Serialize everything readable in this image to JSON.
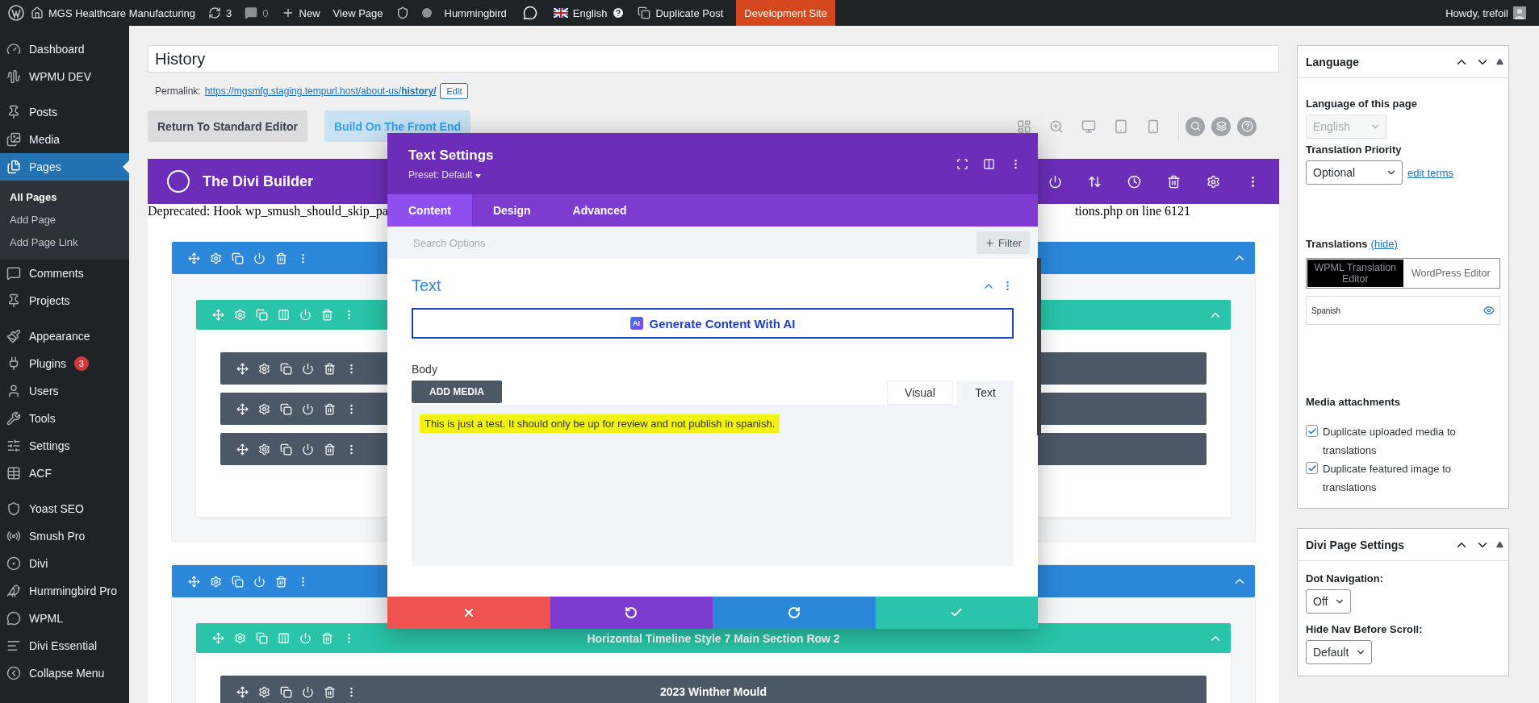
{
  "admin_bar": {
    "site": "MGS Healthcare Manufacturing",
    "updates": "3",
    "comments": "0",
    "new": "New",
    "view": "View Page",
    "hummingbird": "Hummingbird",
    "language": "English",
    "duplicate": "Duplicate Post",
    "environment": "Development Site",
    "greeting": "Howdy, trefoil"
  },
  "sidebar": {
    "groups": [
      [
        {
          "label": "Dashboard",
          "selected": false
        },
        {
          "label": "WPMU DEV",
          "selected": false
        }
      ],
      [
        {
          "label": "Posts",
          "selected": false
        },
        {
          "label": "Media",
          "selected": false
        },
        {
          "label": "Pages",
          "selected": true,
          "children": [
            {
              "label": "All Pages",
              "selected": true
            },
            {
              "label": "Add Page",
              "selected": false
            },
            {
              "label": "Add Page Link",
              "selected": false
            }
          ]
        },
        {
          "label": "Comments",
          "selected": false
        },
        {
          "label": "Projects",
          "selected": false
        }
      ],
      [
        {
          "label": "Appearance",
          "selected": false
        },
        {
          "label": "Plugins",
          "selected": false,
          "badge": "3"
        },
        {
          "label": "Users",
          "selected": false
        },
        {
          "label": "Tools",
          "selected": false
        },
        {
          "label": "Settings",
          "selected": false
        },
        {
          "label": "ACF",
          "selected": false
        }
      ],
      [
        {
          "label": "Yoast SEO",
          "selected": false
        },
        {
          "label": "Smush Pro",
          "selected": false
        },
        {
          "label": "Divi",
          "selected": false
        },
        {
          "label": "Hummingbird Pro",
          "selected": false
        },
        {
          "label": "WPML",
          "selected": false
        },
        {
          "label": "Divi Essential",
          "selected": false
        },
        {
          "label": "Collapse Menu",
          "selected": false
        }
      ]
    ]
  },
  "editor": {
    "title": "History",
    "permalink_label": "Permalink:",
    "permalink_base": "https://mgsmfg.staging.tempurl.host/about-us/",
    "permalink_slug": "history/",
    "edit": "Edit",
    "return_button": "Return To Standard Editor",
    "front_end_button": "Build On The Front End",
    "builder_title": "The Divi Builder",
    "notice_start": "Deprecated: Hook wp_smush_should_skip_pa",
    "notice_end": "tions.php on line 6121"
  },
  "builder": {
    "sections": [
      {
        "kind": "section",
        "rows": [
          {
            "kind": "row",
            "modules": [
              {
                "kind": "module"
              },
              {
                "kind": "module"
              },
              {
                "kind": "module"
              }
            ]
          }
        ]
      },
      {
        "kind": "section",
        "rows": [
          {
            "kind": "row",
            "title": "Horizontal Timeline Style 7 Main Section Row 2",
            "modules": [
              {
                "kind": "module",
                "title": "2023 Winther Mould"
              }
            ]
          }
        ]
      }
    ]
  },
  "modal": {
    "title": "Text Settings",
    "preset": "Preset: Default",
    "tabs": [
      {
        "label": "Content",
        "selected": true
      },
      {
        "label": "Design",
        "selected": false
      },
      {
        "label": "Advanced",
        "selected": false
      }
    ],
    "search": {
      "placeholder": "Search Options"
    },
    "filter": "Filter",
    "group_title": "Text",
    "ai_badge": "AI",
    "ai_button": "Generate Content With AI",
    "body_label": "Body",
    "add_media": "ADD MEDIA",
    "editor_tabs": [
      {
        "label": "Visual",
        "selected": false
      },
      {
        "label": "Text",
        "selected": true
      }
    ],
    "body_text": "This is just a test. It should only be up for review and not publish in spanish."
  },
  "language_box": {
    "title": "Language",
    "page_language_label": "Language of this page",
    "page_language": {
      "value": "English",
      "disabled": true
    },
    "priority_label": "Translation Priority",
    "priority": {
      "value": "Optional",
      "disabled": false
    },
    "edit_terms": "edit terms",
    "translations_label": "Translations",
    "hide_link": "(hide)",
    "editor_tabs": [
      {
        "label": "WPML Translation Editor",
        "selected": true
      },
      {
        "label": "WordPress Editor",
        "selected": false
      }
    ],
    "translation_language": "Spanish",
    "media_title": "Media attachments",
    "options": [
      {
        "label": "Duplicate uploaded media to translations",
        "checked": true
      },
      {
        "label": "Duplicate featured image to translations",
        "checked": true
      }
    ]
  },
  "divi_box": {
    "title": "Divi Page Settings",
    "fields": [
      {
        "label": "Dot Navigation:",
        "value": "Off"
      },
      {
        "label": "Hide Nav Before Scroll:",
        "value": "Default"
      }
    ]
  }
}
